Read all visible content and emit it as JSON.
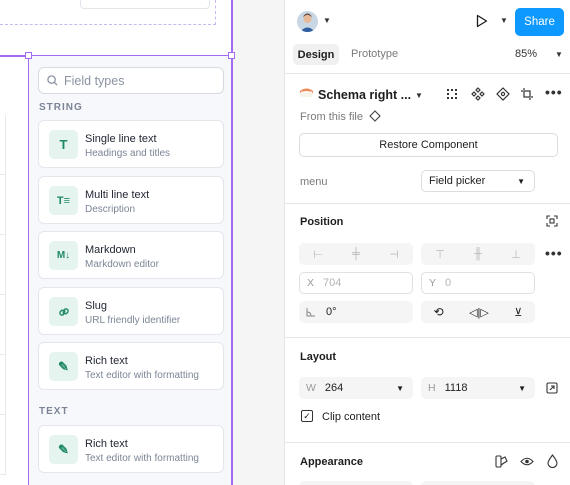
{
  "canvas": {
    "picker": {
      "search_placeholder": "Field types",
      "sections": [
        {
          "label": "STRING",
          "items": [
            {
              "icon": "T",
              "title": "Single line text",
              "subtitle": "Headings and titles"
            },
            {
              "icon": "T≡",
              "title": "Multi line text",
              "subtitle": "Description"
            },
            {
              "icon": "M↓",
              "title": "Markdown",
              "subtitle": "Markdown editor"
            },
            {
              "icon": "🔗",
              "title": "Slug",
              "subtitle": "URL friendly identifier"
            },
            {
              "icon": "✎",
              "title": "Rich text",
              "subtitle": "Text editor with formatting"
            }
          ]
        },
        {
          "label": "TEXT",
          "items": [
            {
              "icon": "✎",
              "title": "Rich text",
              "subtitle": "Text editor with formatting"
            }
          ]
        }
      ]
    },
    "accent_color": "#a26bf2"
  },
  "panel": {
    "share_label": "Share",
    "tabs": [
      "Design",
      "Prototype"
    ],
    "zoom": "85%",
    "component": {
      "name": "Schema right ...",
      "from_file": "From this file",
      "restore_label": "Restore Component",
      "property_label": "menu",
      "property_value": "Field picker"
    },
    "position": {
      "title": "Position",
      "x_label": "X",
      "x_value": "704",
      "y_label": "Y",
      "y_value": "0",
      "rotation": "0°"
    },
    "layout": {
      "title": "Layout",
      "w_label": "W",
      "w_value": "264",
      "h_label": "H",
      "h_value": "1118",
      "clip_label": "Clip content"
    },
    "appearance": {
      "title": "Appearance"
    },
    "share_color": "#0d99ff"
  }
}
